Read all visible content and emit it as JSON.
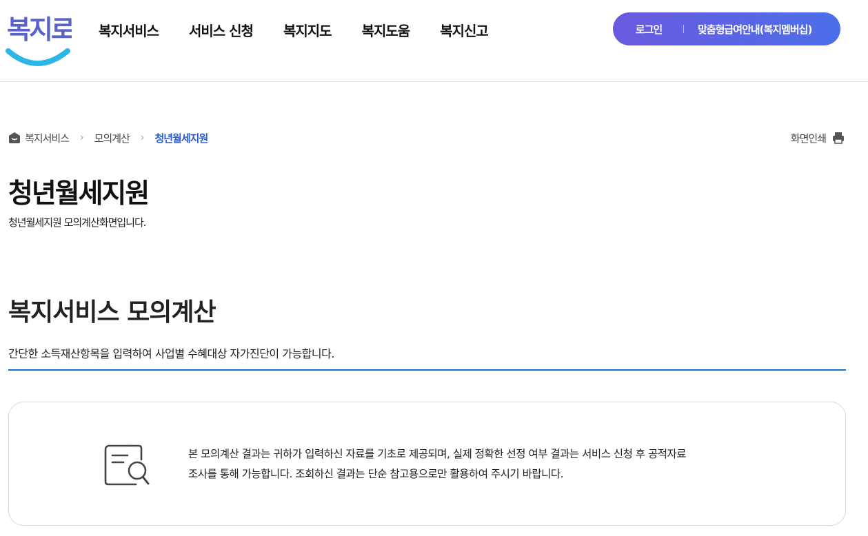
{
  "header": {
    "logo_text": "복지로",
    "nav": [
      "복지서비스",
      "서비스 신청",
      "복지지도",
      "복지도움",
      "복지신고"
    ],
    "login_label": "로그인",
    "guide_label": "맞춤형급여안내(복지멤버십)",
    "gradient_start": "#6a5ae0",
    "gradient_end": "#4c6ee8"
  },
  "breadcrumb": {
    "items": [
      "복지서비스",
      "모의계산",
      "청년월세지원"
    ],
    "current_color": "#2b5ccf"
  },
  "print_label": "화면인쇄",
  "page": {
    "title": "청년월세지원",
    "description": "청년월세지원 모의계산화면입니다."
  },
  "section": {
    "title": "복지서비스 모의계산",
    "description": "간단한 소득재산항목을 입력하여 사업별 수혜대상 자가진단이 가능합니다.",
    "accent_color": "#1c70c4"
  },
  "notice": {
    "line1": "본 모의계산 결과는 귀하가 입력하신 자료를 기초로 제공되며, 실제 정확한 선정 여부 결과는 서비스 신청 후 공적자료",
    "line2": "조사를 통해 가능합니다. 조회하신 결과는 단순 참고용으로만 활용하여 주시기 바랍니다.",
    "icon": "document-search-icon"
  }
}
